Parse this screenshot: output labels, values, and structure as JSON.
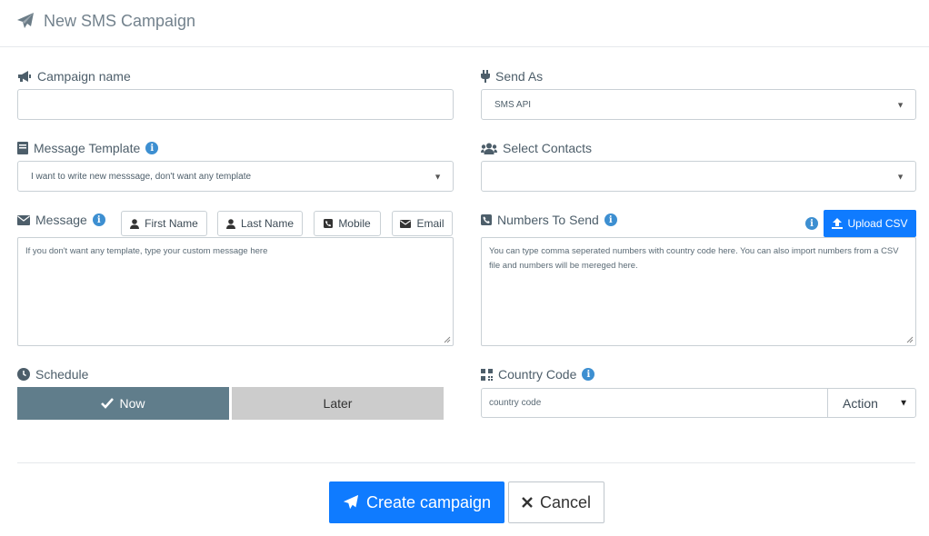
{
  "header": {
    "title": "New SMS Campaign",
    "icon": "paper-plane-icon"
  },
  "campaign_name": {
    "label": "Campaign name",
    "value": ""
  },
  "send_as": {
    "label": "Send As",
    "selected": "SMS API"
  },
  "message_template": {
    "label": "Message Template",
    "selected": "I want to write new messsage, don't want any template"
  },
  "select_contacts": {
    "label": "Select Contacts",
    "selected": ""
  },
  "message": {
    "label": "Message",
    "placeholder": "If you don't want any template, type your custom message here",
    "tags": [
      {
        "label": "First Name",
        "icon": "user-icon"
      },
      {
        "label": "Last Name",
        "icon": "user-icon"
      },
      {
        "label": "Mobile",
        "icon": "phone-square-icon"
      },
      {
        "label": "Email",
        "icon": "envelope-icon"
      }
    ]
  },
  "numbers_to_send": {
    "label": "Numbers To Send",
    "placeholder": "You can type comma seperated numbers with country code here. You can also import numbers from a CSV file and numbers will be mereged here.",
    "upload_label": "Upload CSV"
  },
  "schedule": {
    "label": "Schedule",
    "options": [
      "Now",
      "Later"
    ],
    "selected": "Now"
  },
  "country_code": {
    "label": "Country Code",
    "placeholder": "country code",
    "action_label": "Action"
  },
  "footer": {
    "create_label": "Create campaign",
    "cancel_label": "Cancel"
  },
  "colors": {
    "primary": "#0f7bff",
    "schedule_active": "#607d8b",
    "schedule_inactive": "#cccccc",
    "info": "#3d8fd1"
  }
}
